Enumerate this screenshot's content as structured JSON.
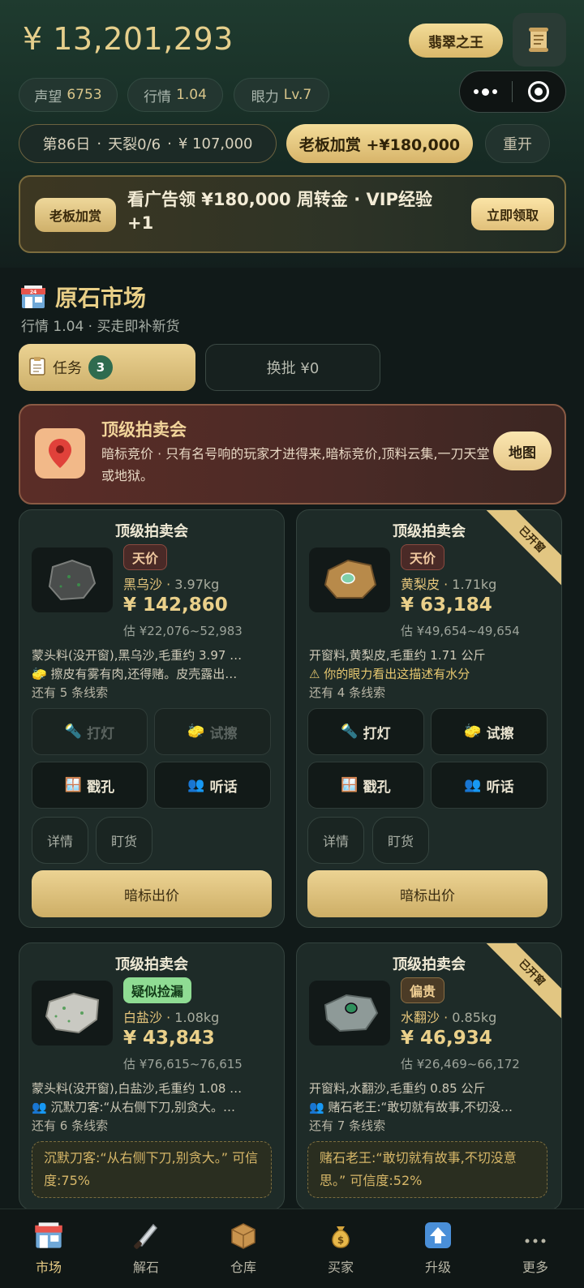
{
  "header": {
    "balance": "¥ 13,201,293",
    "title_badge": "翡翠之王",
    "stats": [
      {
        "label": "声望",
        "value": "6753"
      },
      {
        "label": "行情",
        "value": "1.04"
      },
      {
        "label": "眼力",
        "value": "Lv.7"
      }
    ],
    "day": "第86日",
    "tianlie": "天裂0/6",
    "cash": "¥ 107,000",
    "boss_bonus": "老板加赏 +¥180,000",
    "restart": "重开"
  },
  "banner": {
    "tag": "老板加赏",
    "text": "看广告领 ¥180,000 周转金 · VIP经验 +1",
    "claim": "立即领取"
  },
  "market": {
    "title": "原石市场",
    "subtitle": "行情 1.04 · 买走即补新货",
    "task_label": "任务",
    "task_count": "3",
    "swap_label": "换批 ¥0"
  },
  "auction": {
    "title": "顶级拍卖会",
    "desc": "暗标竞价 · 只有名号响的玩家才进得来,暗标竞价,顶料云集,一刀天堂或地狱。",
    "map": "地图"
  },
  "cards": [
    {
      "title": "顶级拍卖会",
      "badge": "天价",
      "type": "黑乌沙",
      "weight": "3.97kg",
      "price": "¥ 142,860",
      "est": "估 ¥22,076~52,983",
      "clue1": "蒙头料(没开窗),黑乌沙,毛重约 3.97 …",
      "clue2": "🧽 擦皮有雾有肉,还得赌。皮壳露出…",
      "more": "还有 5 条线索",
      "actions": [
        "打灯",
        "试擦",
        "戳孔",
        "听话"
      ],
      "detail": "详情",
      "watch": "盯货",
      "bid": "暗标出价"
    },
    {
      "title": "顶级拍卖会",
      "ribbon": "已开窗",
      "badge": "天价",
      "type": "黄梨皮",
      "weight": "1.71kg",
      "price": "¥ 63,184",
      "est": "估 ¥49,654~49,654",
      "clue1": "开窗料,黄梨皮,毛重约 1.71 公斤",
      "clue2": "⚠ 你的眼力看出这描述有水分",
      "more": "还有 4 条线索",
      "actions": [
        "打灯",
        "试擦",
        "戳孔",
        "听话"
      ],
      "detail": "详情",
      "watch": "盯货",
      "bid": "暗标出价"
    },
    {
      "title": "顶级拍卖会",
      "badge": "疑似捡漏",
      "type": "白盐沙",
      "weight": "1.08kg",
      "price": "¥ 43,843",
      "est": "估 ¥76,615~76,615",
      "clue1": "蒙头料(没开窗),白盐沙,毛重约 1.08 …",
      "clue2": "👥 沉默刀客:“从右侧下刀,别贪大。…",
      "more": "还有 6 条线索",
      "quote": "沉默刀客:“从右侧下刀,别贪大。” 可信度:75%"
    },
    {
      "title": "顶级拍卖会",
      "ribbon": "已开窗",
      "badge": "偏贵",
      "type": "水翻沙",
      "weight": "0.85kg",
      "price": "¥ 46,934",
      "est": "估 ¥26,469~66,172",
      "clue1": "开窗料,水翻沙,毛重约 0.85 公斤",
      "clue2": "👥 赌石老王:“敢切就有故事,不切没…",
      "more": "还有 7 条线索",
      "quote": "赌石老王:“敢切就有故事,不切没意思。” 可信度:52%"
    }
  ],
  "tabbar": [
    {
      "label": "市场",
      "icon": "store-icon"
    },
    {
      "label": "解石",
      "icon": "knife-icon"
    },
    {
      "label": "仓库",
      "icon": "box-icon"
    },
    {
      "label": "买家",
      "icon": "money-bag-icon"
    },
    {
      "label": "升级",
      "icon": "up-arrow-icon"
    },
    {
      "label": "更多",
      "icon": "more-icon"
    }
  ]
}
